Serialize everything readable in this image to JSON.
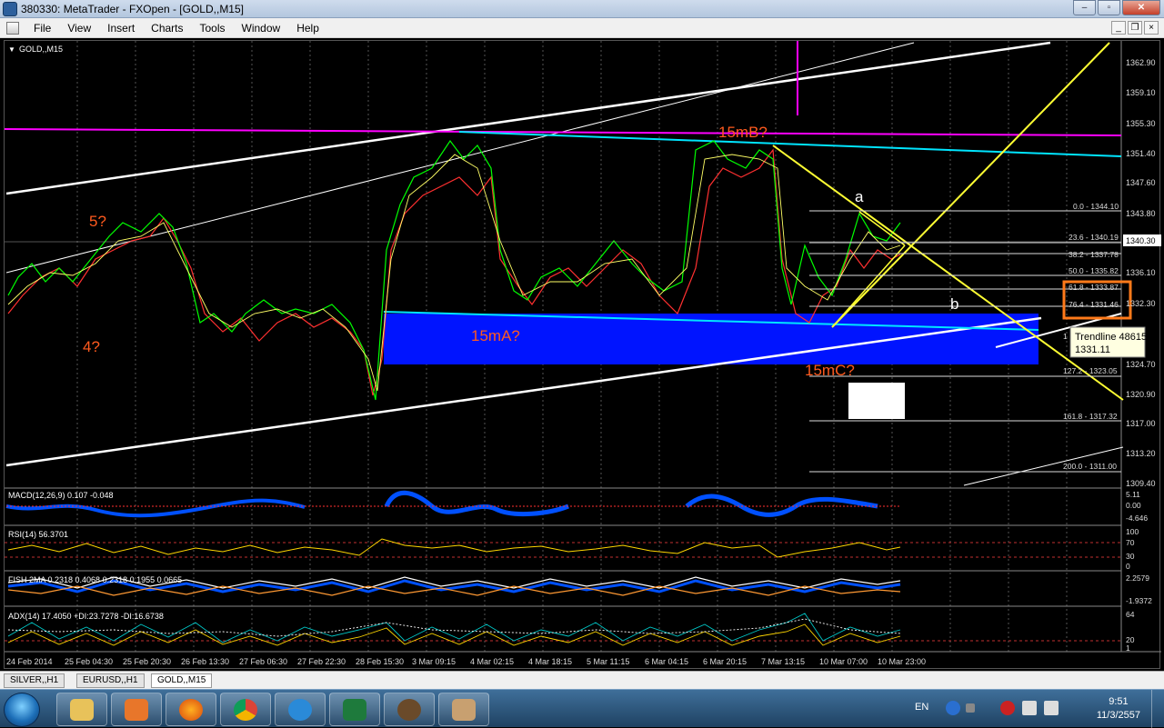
{
  "window": {
    "title": "380330: MetaTrader - FXOpen - [GOLD,,M15]"
  },
  "menu": [
    "File",
    "View",
    "Insert",
    "Charts",
    "Tools",
    "Window",
    "Help"
  ],
  "chart": {
    "symbol_label": "GOLD,,M15",
    "price_labels": [
      "1362.90",
      "1359.10",
      "1355.30",
      "1351.40",
      "1347.60",
      "1343.80",
      "1336.10",
      "1332.30",
      "1324.70",
      "1320.90",
      "1317.00",
      "1313.20",
      "1309.40"
    ],
    "current_price": "1340.30",
    "time_labels": [
      "24 Feb 2014",
      "25 Feb 04:30",
      "25 Feb 20:30",
      "26 Feb 13:30",
      "27 Feb 06:30",
      "27 Feb 22:30",
      "28 Feb 15:30",
      "3 Mar 09:15",
      "4 Mar 02:15",
      "4 Mar 18:15",
      "5 Mar 11:15",
      "6 Mar 04:15",
      "6 Mar 20:15",
      "7 Mar 13:15",
      "10 Mar 07:00",
      "10 Mar 23:00"
    ],
    "annotations": {
      "wave_5": "5?",
      "wave_4": "4?",
      "wave_15mA": "15mA?",
      "wave_15mB": "15mB?",
      "wave_15mC": "15mC?",
      "wave_a": "a",
      "wave_b": "b"
    },
    "fib_levels": [
      "0.0 - 1344.10",
      "23.6 - 1340.19",
      "38.2 - 1337.78",
      "50.0 - 1335.82",
      "61.8 - 1333.87",
      "76.4 - 1331.46",
      "127.2 - 1323.05",
      "161.8 - 1317.32",
      "200.0 - 1311.00"
    ],
    "fib_partial": "1",
    "tooltip": {
      "line1": "Trendline 48615",
      "line2": "1331.11"
    }
  },
  "indicators": {
    "macd": {
      "label": "MACD(12,26,9) 0.107 -0.048",
      "scale": [
        "5.11",
        "0.00",
        "-4.646"
      ]
    },
    "rsi": {
      "label": "RSI(14) 56.3701",
      "scale": [
        "100",
        "70",
        "30",
        "0"
      ]
    },
    "fisher": {
      "label": "FISH  2MA 0.2318 0.4068 0.2318 0.1955 0.0665",
      "scale": [
        "2.2579",
        "-1.9372"
      ]
    },
    "adx": {
      "label": "ADX(14) 17.4050 +DI:23.7278 -DI:16.6738",
      "scale": [
        "64",
        "20",
        "1"
      ]
    }
  },
  "tabs": [
    "SILVER,,H1",
    "EURUSD,,H1",
    "GOLD,,M15"
  ],
  "active_tab": "GOLD,,M15",
  "tray": {
    "language": "EN",
    "time": "9:51",
    "date": "11/3/2557"
  },
  "colors": {
    "bg": "#000000",
    "candle_up": "#00ff00",
    "candle_down": "#ff3030",
    "channel": "#ffffff",
    "resistance": "#ff00ff",
    "cyan_line": "#00e5ff",
    "zone": "#0014ff",
    "fan": "#ffff33",
    "annot": "#ff5a1e",
    "highlight_box": "#ff7a1a"
  }
}
